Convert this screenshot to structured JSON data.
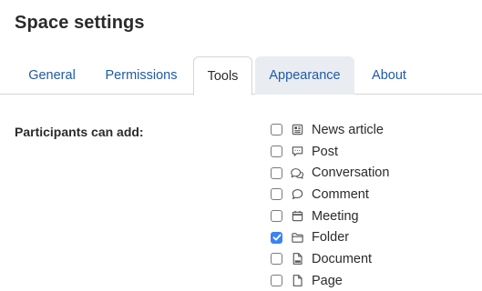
{
  "page": {
    "title": "Space settings"
  },
  "tabs": [
    {
      "label": "General",
      "active": false
    },
    {
      "label": "Permissions",
      "active": false
    },
    {
      "label": "Tools",
      "active": true
    },
    {
      "label": "Appearance",
      "active": false
    },
    {
      "label": "About",
      "active": false
    }
  ],
  "tools": {
    "section_label": "Participants can add:",
    "options": [
      {
        "label": "News article",
        "icon": "newspaper-icon",
        "checked": false
      },
      {
        "label": "Post",
        "icon": "speech-bubble-icon",
        "checked": false
      },
      {
        "label": "Conversation",
        "icon": "conversation-icon",
        "checked": false
      },
      {
        "label": "Comment",
        "icon": "comment-icon",
        "checked": false
      },
      {
        "label": "Meeting",
        "icon": "calendar-icon",
        "checked": false
      },
      {
        "label": "Folder",
        "icon": "folder-icon",
        "checked": true
      },
      {
        "label": "Document",
        "icon": "document-icon",
        "checked": false
      },
      {
        "label": "Page",
        "icon": "page-icon",
        "checked": false
      }
    ]
  },
  "colors": {
    "link": "#1f5aa8",
    "check_accent": "#3b82f6",
    "hover_tab": "#e9ecf1"
  }
}
